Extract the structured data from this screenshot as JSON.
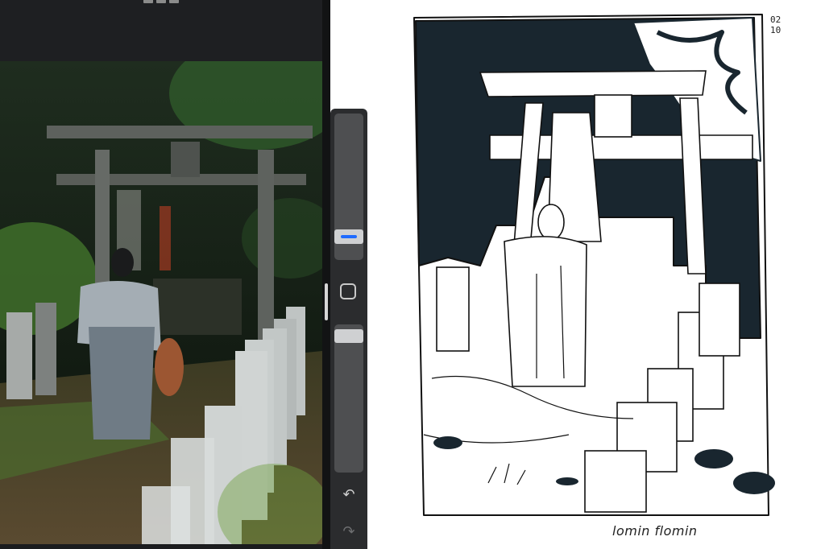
{
  "reference_panel": {
    "photo_subject": "reference-photo"
  },
  "toolbar": {
    "undo_label": "↶",
    "redo_label": "↷",
    "modify_label": ""
  },
  "sketch": {
    "signature": "lomin flomin",
    "margin_note": "0210"
  },
  "colors": {
    "ui_dark": "#1e1f22",
    "toolbar": "#2b2c2e",
    "slider_track": "#4e4f51",
    "accent": "#1f6bff",
    "ink": "#19262f"
  },
  "icons": {
    "undo": "undo-icon",
    "redo": "redo-icon",
    "modify": "square-modify-icon"
  }
}
